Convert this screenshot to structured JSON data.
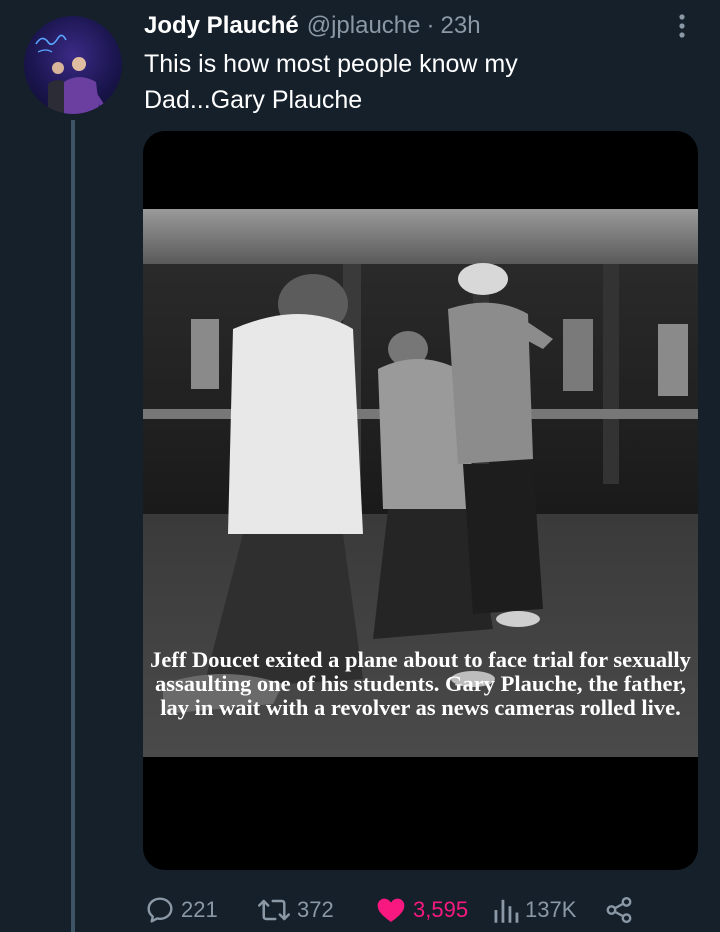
{
  "author": {
    "display_name": "Jody Plauché",
    "handle": "@jplauche",
    "separator": "·",
    "time": "23h"
  },
  "tweet": {
    "text": "This is how most people know my Dad...Gary Plauche"
  },
  "media": {
    "caption": "Jeff Doucet exited a plane about to face trial for sexually assaulting one of his students. Gary Plauche, the father, lay in wait with a revolver as news cameras rolled live."
  },
  "actions": {
    "replies": "221",
    "retweets": "372",
    "likes": "3,595",
    "views": "137K"
  },
  "icons": {
    "more": "more-vertical-icon",
    "reply": "reply-icon",
    "retweet": "retweet-icon",
    "like": "heart-icon",
    "views": "views-icon",
    "share": "share-icon"
  },
  "colors": {
    "background": "#15202b",
    "secondary_text": "#8b98a5",
    "like_pink": "#f91880",
    "thread_line": "#3d5466"
  }
}
